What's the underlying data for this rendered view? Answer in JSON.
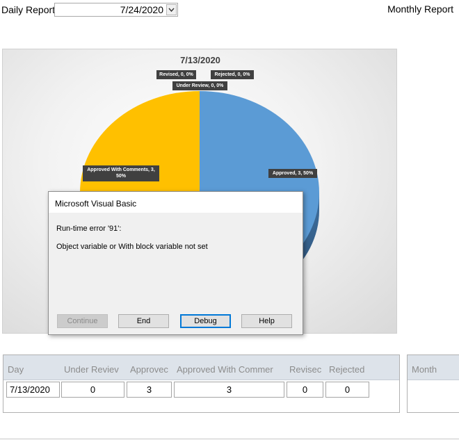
{
  "header": {
    "daily_label": "Daily Report",
    "date_value": "7/24/2020",
    "monthly_label": "Monthly Report"
  },
  "chart_data": {
    "type": "pie",
    "title": "7/13/2020",
    "slices": [
      {
        "name": "Approved",
        "value": 3,
        "percent": "50%",
        "color": "#5b9bd5"
      },
      {
        "name": "Approved With Comments",
        "value": 3,
        "percent": "50%",
        "color": "#ffc000"
      },
      {
        "name": "Revised",
        "value": 0,
        "percent": "0%"
      },
      {
        "name": "Rejected",
        "value": 0,
        "percent": "0%"
      },
      {
        "name": "Under Review",
        "value": 0,
        "percent": "0%"
      }
    ],
    "labels": {
      "revised": "Revised, 0, 0%",
      "rejected": "Rejected, 0, 0%",
      "under_review": "Under Review, 0, 0%",
      "approved_with_comments_1": "Approved With Comments, 3,",
      "approved_with_comments_2": "50%",
      "approved": "Approved, 3, 50%"
    }
  },
  "dialog": {
    "title": "Microsoft Visual Basic",
    "line1": "Run-time error '91':",
    "line2": "Object variable or With block variable not set",
    "buttons": {
      "continue": "Continue",
      "end": "End",
      "debug": "Debug",
      "help": "Help"
    }
  },
  "table": {
    "headers": [
      "Day",
      "Under Reviev",
      "Approvec",
      "Approved With Commer",
      "Revisec",
      "Rejected"
    ],
    "row": [
      "7/13/2020",
      "0",
      "3",
      "3",
      "0",
      "0"
    ]
  },
  "month_table": {
    "header": "Month"
  },
  "colors": {
    "approved": "#5b9bd5",
    "approved_with_comments": "#ffc000",
    "dialog_default_button_border": "#0078d7",
    "table_header_bg": "#dde3ea"
  }
}
